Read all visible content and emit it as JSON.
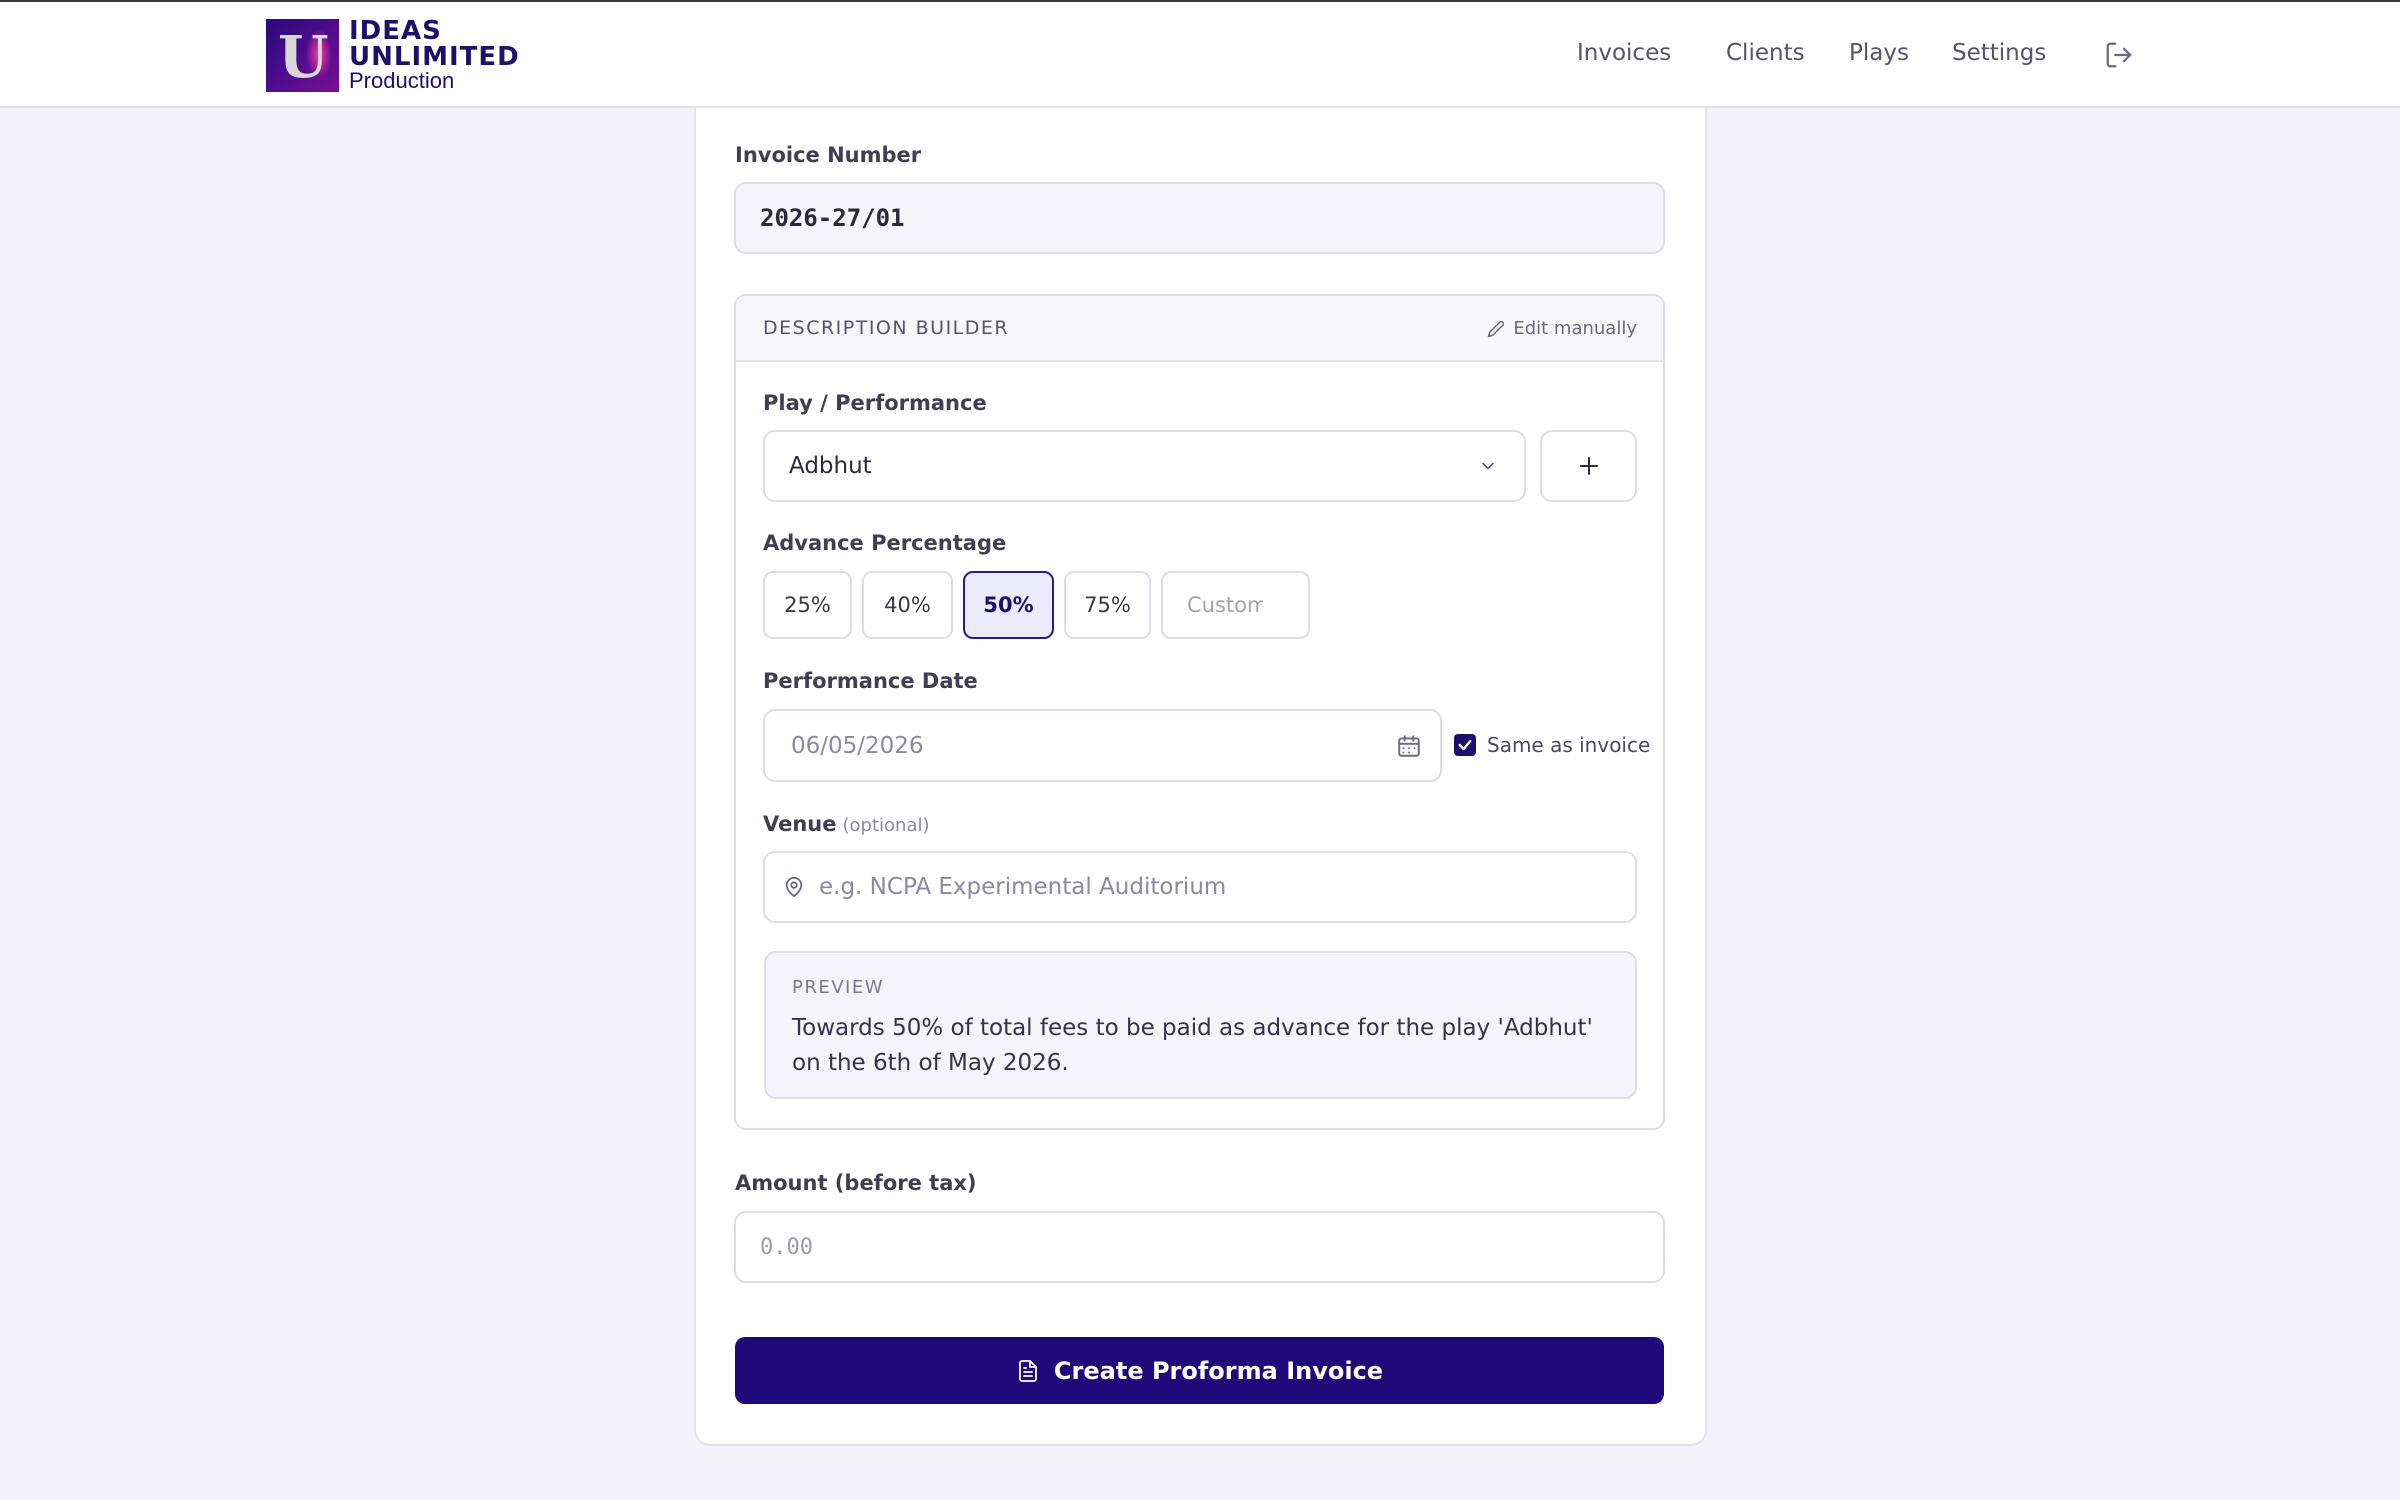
{
  "brand": {
    "line1": "IDEAS",
    "line2": "UNLIMITED",
    "line3": "Production"
  },
  "nav": {
    "items": [
      "Invoices",
      "Clients",
      "Plays",
      "Settings"
    ],
    "logout_icon": "logout-icon"
  },
  "form": {
    "invoice_number_label": "Invoice Number",
    "invoice_number_value": "2026-27/01",
    "builder": {
      "title": "DESCRIPTION BUILDER",
      "edit_manually": "Edit manually",
      "play_label": "Play / Performance",
      "play_selected": "Adbhut",
      "add_play_icon": "plus-icon",
      "advance_label": "Advance Percentage",
      "percentages": [
        "25%",
        "40%",
        "50%",
        "75%"
      ],
      "selected_percentage": "50%",
      "custom_placeholder": "Custom",
      "date_label": "Performance Date",
      "date_value": "06/05/2026",
      "same_as_invoice_label": "Same as invoice",
      "same_as_invoice_checked": true,
      "venue_label": "Venue",
      "venue_optional": "(optional)",
      "venue_placeholder": "e.g. NCPA Experimental Auditorium",
      "preview_title": "PREVIEW",
      "preview_text": "Towards 50% of total fees to be paid as advance for the play 'Adbhut' on the 6th of May 2026."
    },
    "amount_label": "Amount (before tax)",
    "amount_placeholder": "0.00",
    "submit_label": "Create Proforma Invoice"
  },
  "colors": {
    "primary": "#1e0a78",
    "background": "#f3f2f8",
    "border": "#dddce8"
  }
}
